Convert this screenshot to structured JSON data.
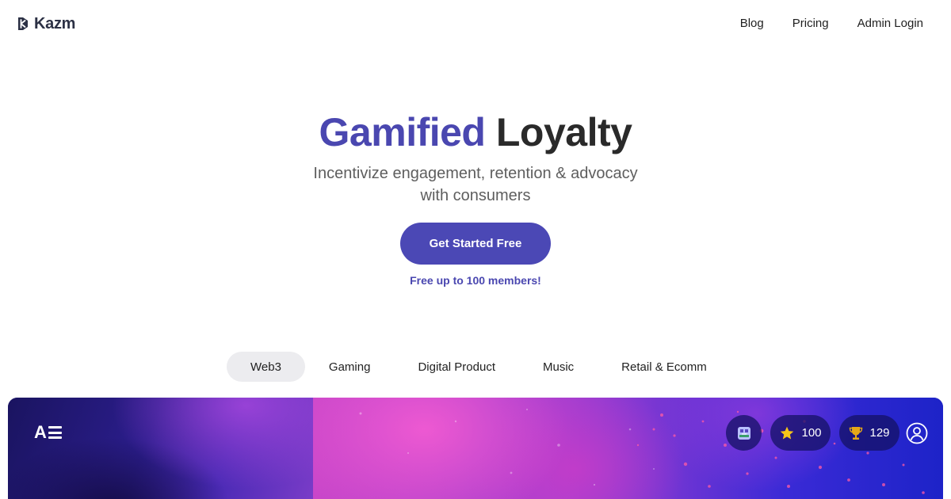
{
  "header": {
    "brand": "Kazm",
    "nav": [
      {
        "label": "Blog"
      },
      {
        "label": "Pricing"
      },
      {
        "label": "Admin Login"
      }
    ]
  },
  "hero": {
    "title_accent": "Gamified",
    "title_rest": "Loyalty",
    "subtitle_line1": "Incentivize engagement, retention & advocacy",
    "subtitle_line2": "with consumers",
    "cta_label": "Get Started Free",
    "cta_note": "Free up to 100 members!"
  },
  "tabs": {
    "active": "Web3",
    "items": [
      {
        "label": "Web3"
      },
      {
        "label": "Gaming"
      },
      {
        "label": "Digital Product"
      },
      {
        "label": "Music"
      },
      {
        "label": "Retail & Ecomm"
      }
    ]
  },
  "preview": {
    "brand_logo": "AE",
    "stats": {
      "stars": "100",
      "trophies": "129"
    },
    "icons": [
      "avatar-icon",
      "star-icon",
      "trophy-icon",
      "profile-icon"
    ]
  },
  "colors": {
    "accent": "#4a47b0",
    "cta_bg": "#4b48b5",
    "tab_active_bg": "#ececef",
    "star": "#f5c518",
    "trophy": "#e6a817"
  }
}
